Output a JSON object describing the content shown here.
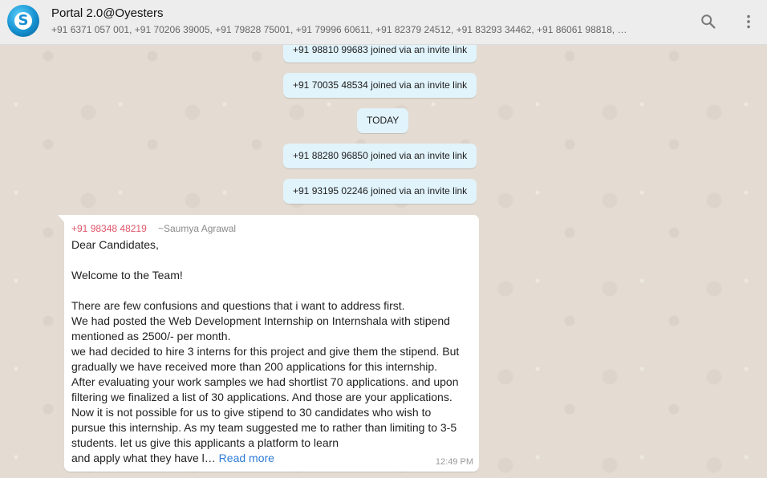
{
  "header": {
    "title": "Portal 2.0@Oyesters",
    "participants": "+91 6371 057 001, +91 70206 39005, +91 79828 75001, +91 79996 60611, +91 82379 24512, +91 83293 34462, +91 86061 98818, …",
    "avatar_letter": "S",
    "icons": [
      "search-icon",
      "menu-icon"
    ]
  },
  "system_messages": [
    "+91 98810 99683 joined via an invite link",
    "+91 70035 48534 joined via an invite link",
    "TODAY",
    "+91 88280 96850 joined via an invite link",
    "+91 93195 02246 joined via an invite link"
  ],
  "message": {
    "sender": "+91 98348 48219",
    "alias": "~Saumya Agrawal",
    "lines": [
      "Dear Candidates,",
      "",
      "Welcome to the Team!",
      "",
      "There are few confusions and questions that i want to address first.",
      "We had posted the Web Development Internship on Internshala with stipend",
      "mentioned as 2500/- per month.",
      "we had decided to hire 3 interns for this project and give them the stipend. But",
      "gradually we have received more than 200 applications for this internship.",
      "After evaluating your work samples we had shortlist 70 applications. and upon",
      "filtering we finalized a list of 30 applications. And those are your applications.",
      "Now it is not possible for us to give stipend to 30 candidates who wish to",
      "pursue this internship. As my team suggested me to rather than limiting to 3-5",
      "students. let us give this applicants a platform to learn",
      "and apply what they have l…"
    ],
    "read_more": "Read more",
    "time": "12:49 PM"
  },
  "colors": {
    "header_bg": "#ededed",
    "system_bubble": "#e1f3fb",
    "sender_color": "#e0566a",
    "link_color": "#2f7bd6"
  }
}
